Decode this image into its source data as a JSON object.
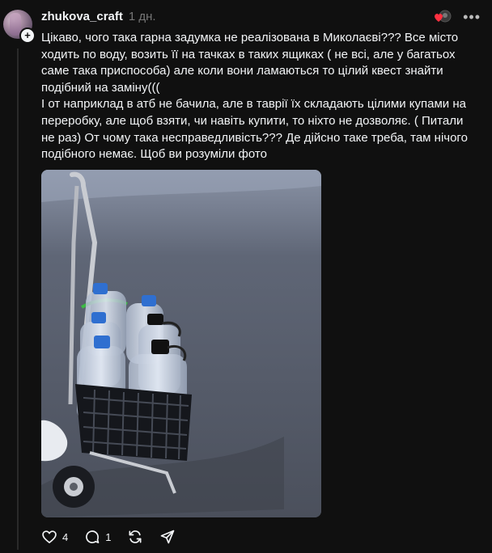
{
  "post": {
    "username": "zhukova_craft",
    "timestamp": "1 дн.",
    "text": "Цікаво, чого така гарна задумка не реалізована в Миколаєві??? Все місто ходить по воду, возить її на тачках в таких ящиках ( не всі, але у багатьох саме така приспособа) але коли вони ламаються то цілий квест знайти подібний на заміну(((\nІ от наприклад в атб не бачила, але в таврії їх складають цілими купами на переробку, але щоб взяти, чи навіть купити, то ніхто не дозволяє. ( Питали не раз) От чому така несправедливість??? Де дійсно таке треба, там нічого подібного немає. Щоб ви розуміли фото",
    "likes": "4",
    "replies": "1"
  },
  "icons": {
    "like": "heart-icon",
    "reply": "comment-icon",
    "repost": "repost-icon",
    "share": "share-icon",
    "more": "more-icon",
    "follow": "plus-icon"
  }
}
